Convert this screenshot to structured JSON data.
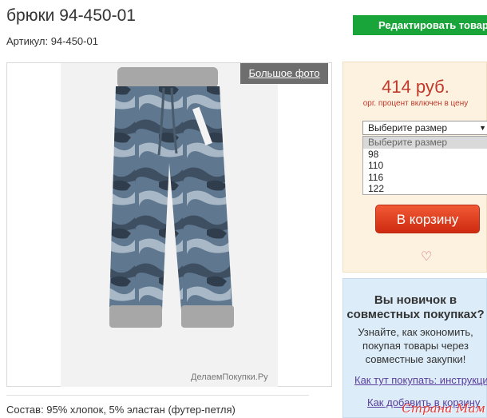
{
  "product": {
    "title": "брюки 94-450-01",
    "article_label": "Артикул: 94-450-01",
    "composition": "Состав: 95% хлопок, 5% эластан (футер-петля)"
  },
  "toolbar": {
    "edit_label": "Редактировать товар"
  },
  "photo": {
    "big_photo_label": "Большое фото",
    "watermark": "ДелаемПокупки.Ру"
  },
  "pricing": {
    "price": "414 руб.",
    "note": "орг. процент включен в цену"
  },
  "size_select": {
    "selected": "Выберите размер",
    "options": [
      "Выберите размер",
      "98",
      "110",
      "116",
      "122"
    ]
  },
  "cart": {
    "button_label": "В корзину"
  },
  "newbie": {
    "title": "Вы новичок в совместных покупках?",
    "text": "Узнайте, как экономить, покупая товары через совместные закупки!",
    "link1": "Как тут покупать: инструкция",
    "link2": "Как добавить в корзину"
  },
  "site_watermark": "Страна Мам",
  "colors": {
    "accent_green": "#1aa53a",
    "price_red": "#c0392b",
    "cart_orange": "#e8431f"
  }
}
